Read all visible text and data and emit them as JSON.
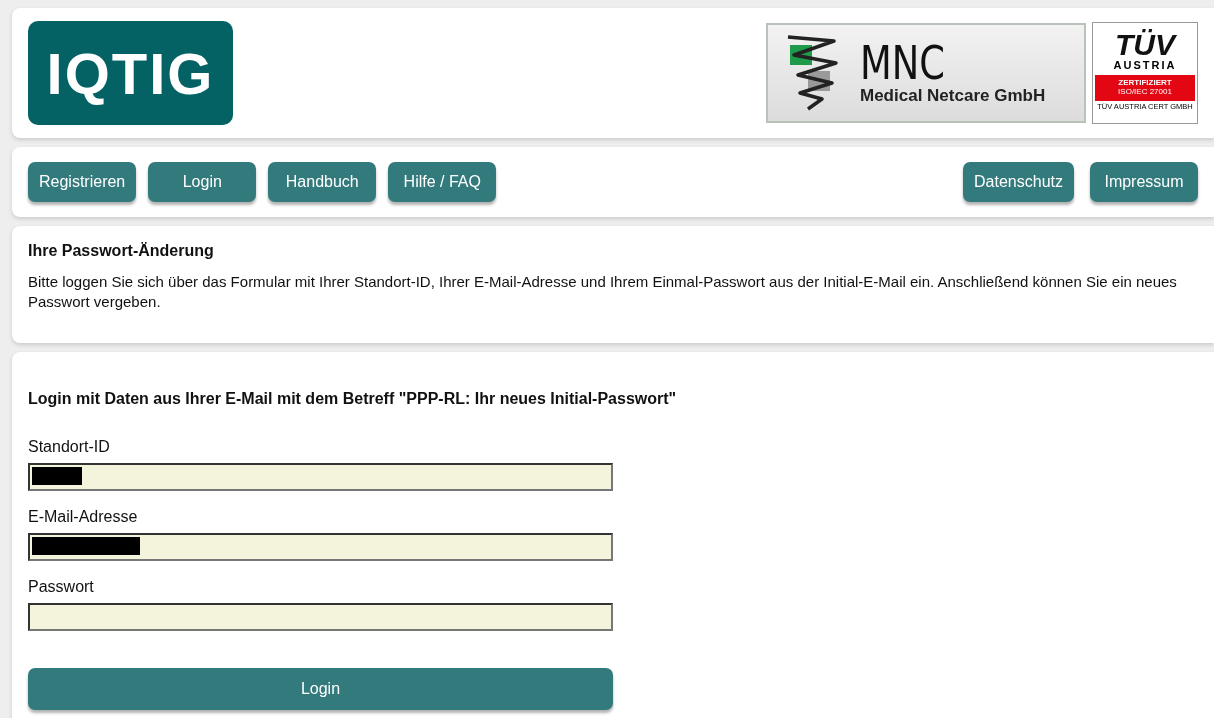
{
  "header": {
    "logo": "IQTIG",
    "partner": {
      "mark": "MNC",
      "name": "Medical Netcare GmbH"
    },
    "cert": {
      "brand": "TÜV",
      "country": "AUSTRIA",
      "badge": "ZERTIFIZIERT",
      "standard": "ISO/IEC 27001",
      "issuer": "TÜV AUSTRIA CERT GMBH"
    }
  },
  "nav": {
    "left": [
      "Registrieren",
      "Login",
      "Handbuch",
      "Hilfe / FAQ"
    ],
    "right": [
      "Datenschutz",
      "Impressum"
    ]
  },
  "info": {
    "title": "Ihre Passwort-Änderung",
    "text": "Bitte loggen Sie sich über das Formular mit Ihrer Standort-ID, Ihrer E-Mail-Adresse und Ihrem Einmal-Passwort aus der Initial-E-Mail ein. Anschließend können Sie ein neues Passwort vergeben."
  },
  "login": {
    "title": "Login mit Daten aus Ihrer E-Mail mit dem Betreff \"PPP-RL: Ihr neues Initial-Passwort\"",
    "fields": [
      {
        "label": "Standort-ID",
        "redacted": true
      },
      {
        "label": "E-Mail-Adresse",
        "redacted": true
      },
      {
        "label": "Passwort",
        "redacted": false
      }
    ],
    "button": "Login"
  }
}
